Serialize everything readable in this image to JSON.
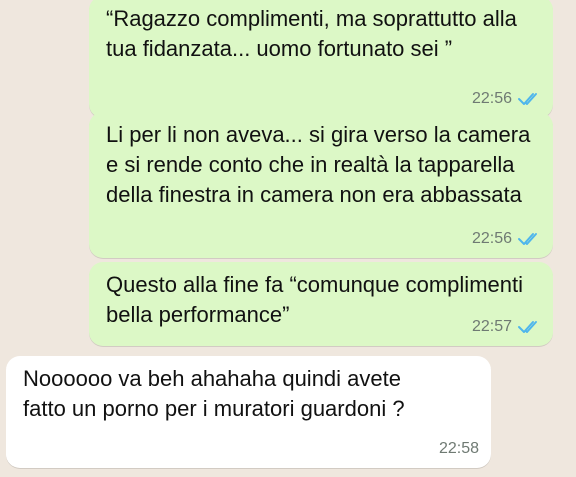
{
  "theme": {
    "outgoing_bubble": "#dcf8c6",
    "incoming_bubble": "#ffffff",
    "read_ticks": "#4fb6ec",
    "time_text": "#6f7a73"
  },
  "messages": [
    {
      "direction": "outgoing",
      "text": "“Ragazzo complimenti, ma soprattutto alla\ntua fidanzata... uomo fortunato sei ”",
      "time": "22:56",
      "status_icon": "double-check-read-icon"
    },
    {
      "direction": "outgoing",
      "text": "Li per li non aveva... si gira verso la camera\ne si rende conto che in realtà la tapparella\ndella finestra in camera non era abbassata",
      "time": "22:56",
      "status_icon": "double-check-read-icon"
    },
    {
      "direction": "outgoing",
      "text": "Questo alla fine fa “comunque complimenti\nbella performance”",
      "time": "22:57",
      "status_icon": "double-check-read-icon"
    },
    {
      "direction": "incoming",
      "text": "Noooooo va beh ahahaha quindi avete\nfatto un porno per i muratori guardoni ?",
      "time": "22:58"
    }
  ]
}
